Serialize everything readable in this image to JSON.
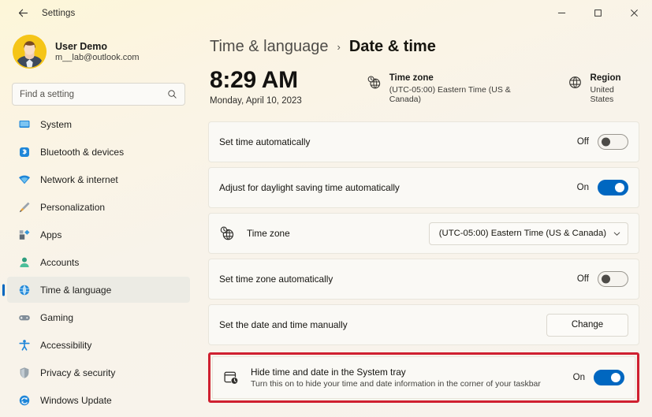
{
  "window": {
    "title": "Settings",
    "back_icon": "back-arrow-icon",
    "minimize_label": "−",
    "maximize_label": "☐",
    "close_label": "✕"
  },
  "account": {
    "name": "User Demo",
    "email": "m__lab@outlook.com",
    "avatar_color": "#f5c518"
  },
  "search": {
    "placeholder": "Find a setting",
    "value": "",
    "icon": "search-icon"
  },
  "sidebar": {
    "accent_color": "#0067c0",
    "items": [
      {
        "label": "System",
        "icon": "monitor-icon",
        "active": false
      },
      {
        "label": "Bluetooth & devices",
        "icon": "bluetooth-icon",
        "active": false
      },
      {
        "label": "Network & internet",
        "icon": "wifi-icon",
        "active": false
      },
      {
        "label": "Personalization",
        "icon": "paintbrush-icon",
        "active": false
      },
      {
        "label": "Apps",
        "icon": "apps-icon",
        "active": false
      },
      {
        "label": "Accounts",
        "icon": "person-icon",
        "active": false
      },
      {
        "label": "Time & language",
        "icon": "globe-clock-icon",
        "active": true
      },
      {
        "label": "Gaming",
        "icon": "gamepad-icon",
        "active": false
      },
      {
        "label": "Accessibility",
        "icon": "accessibility-icon",
        "active": false
      },
      {
        "label": "Privacy & security",
        "icon": "shield-icon",
        "active": false
      },
      {
        "label": "Windows Update",
        "icon": "update-icon",
        "active": false
      }
    ]
  },
  "breadcrumb": {
    "parent": "Time & language",
    "separator": "›",
    "current": "Date & time"
  },
  "clock": {
    "time": "8:29 AM",
    "date": "Monday, April 10, 2023"
  },
  "timezone_info": {
    "icon": "globe-clock-icon",
    "title": "Time zone",
    "value": "(UTC-05:00) Eastern Time (US & Canada)"
  },
  "region_info": {
    "icon": "globe-icon",
    "title": "Region",
    "value": "United States"
  },
  "settings": {
    "set_time_automatically": {
      "title": "Set time automatically",
      "state_label": "Off",
      "state": "off"
    },
    "adjust_dst": {
      "title": "Adjust for daylight saving time automatically",
      "state_label": "On",
      "state": "on"
    },
    "time_zone": {
      "icon": "globe-clock-icon",
      "title": "Time zone",
      "selected": "(UTC-05:00) Eastern Time (US & Canada)",
      "chevron": "chevron-down-icon"
    },
    "set_time_zone_automatically": {
      "title": "Set time zone automatically",
      "state_label": "Off",
      "state": "off"
    },
    "set_date_time_manually": {
      "title": "Set the date and time manually",
      "button_label": "Change"
    },
    "hide_time_date": {
      "icon": "calendar-clock-icon",
      "title": "Hide time and date in the System tray",
      "subtitle": "Turn this on to hide your time and date information in the corner of your taskbar",
      "state_label": "On",
      "state": "on",
      "highlight_color": "#cf2030"
    }
  }
}
